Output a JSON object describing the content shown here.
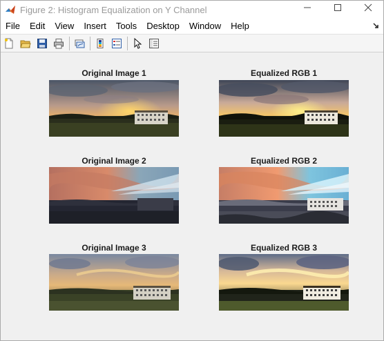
{
  "window": {
    "title": "Figure 2: Histogram Equalization on Y Channel"
  },
  "menu": {
    "items": [
      "File",
      "Edit",
      "View",
      "Insert",
      "Tools",
      "Desktop",
      "Window",
      "Help"
    ]
  },
  "toolbar": {
    "icons": [
      "new-figure-icon",
      "open-file-icon",
      "save-icon",
      "print-icon",
      "link-plot-icon",
      "colorbar-icon",
      "legend-icon",
      "pointer-icon",
      "property-inspector-icon"
    ]
  },
  "panels": [
    {
      "title": "Original Image 1"
    },
    {
      "title": "Equalized RGB 1"
    },
    {
      "title": "Original Image 2"
    },
    {
      "title": "Equalized RGB 2"
    },
    {
      "title": "Original Image 3"
    },
    {
      "title": "Equalized RGB 3"
    }
  ]
}
